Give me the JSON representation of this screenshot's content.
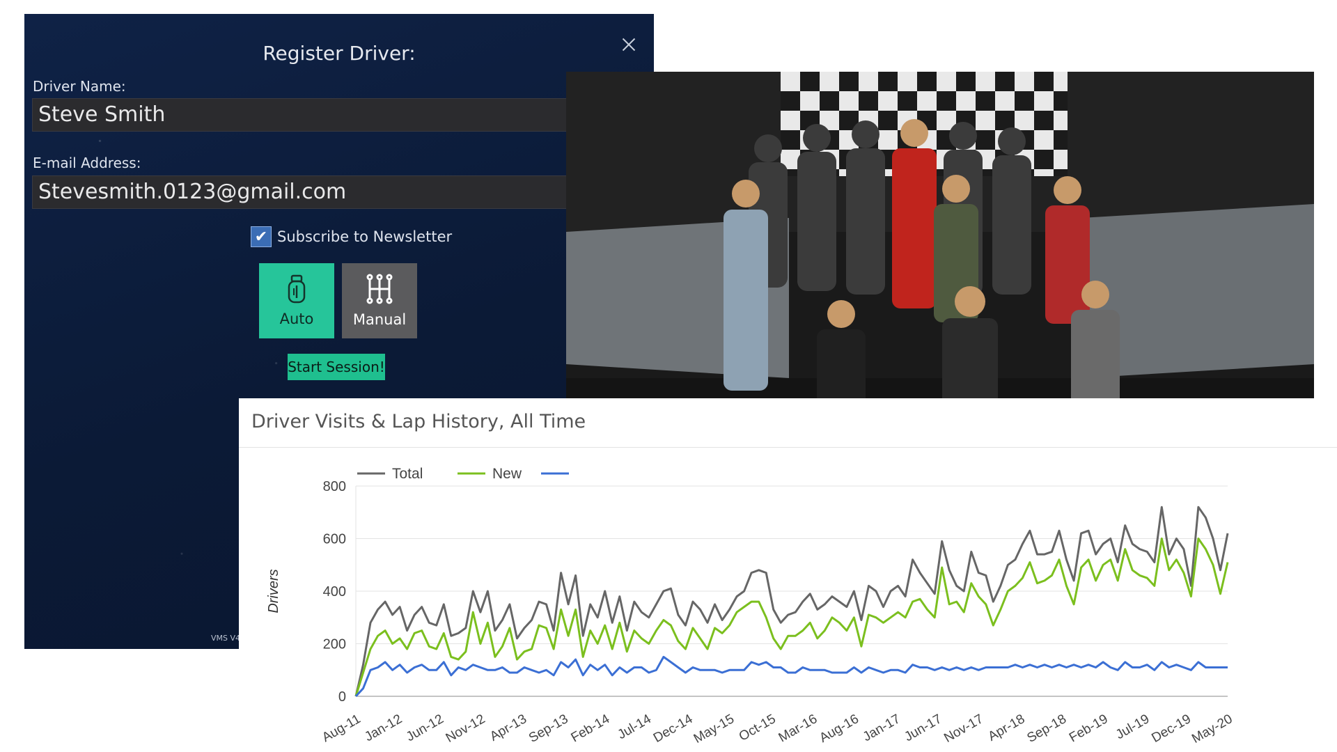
{
  "register": {
    "title": "Register Driver:",
    "name_label": "Driver Name:",
    "name_value": "Steve Smith",
    "email_label": "E-mail Address:",
    "email_value": "Stevesmith.0123@gmail.com",
    "newsletter_label": "Subscribe to Newsletter",
    "newsletter_checked": true,
    "auto_label": "Auto",
    "manual_label": "Manual",
    "start_label": "Start Session!",
    "version": "VMS V4"
  },
  "colors": {
    "panel_bg": "#0e1d3a",
    "auto_bg": "#26c59a",
    "manual_bg": "#5b5b5d",
    "start_bg": "#1fbf8f",
    "total": "#666666",
    "new": "#7bbf1e",
    "returning": "#3b6fd4"
  },
  "chart": {
    "title": "Driver Visits & Lap History, All Time"
  },
  "chart_data": {
    "type": "line",
    "title": "Driver Visits & Lap History, All Time",
    "ylabel": "Drivers",
    "xlabel": "",
    "ylim": [
      0,
      800
    ],
    "yticks": [
      0,
      200,
      400,
      600,
      800
    ],
    "xtick_labels": [
      "Aug-11",
      "Jan-12",
      "Jun-12",
      "Nov-12",
      "Apr-13",
      "Sep-13",
      "Feb-14",
      "Jul-14",
      "Dec-14",
      "May-15",
      "Oct-15",
      "Mar-16",
      "Aug-16",
      "Jan-17",
      "Jun-17",
      "Nov-17",
      "Apr-18",
      "Sep-18",
      "Feb-19",
      "Jul-19",
      "Dec-19",
      "May-20"
    ],
    "legend_position": "top-left",
    "series": [
      {
        "name": "Total",
        "color": "#666666",
        "values": [
          0,
          120,
          280,
          330,
          360,
          310,
          340,
          250,
          310,
          340,
          280,
          270,
          350,
          230,
          240,
          260,
          400,
          320,
          400,
          250,
          290,
          350,
          220,
          260,
          290,
          360,
          350,
          250,
          470,
          350,
          460,
          230,
          350,
          300,
          400,
          280,
          380,
          250,
          360,
          320,
          300,
          350,
          400,
          410,
          310,
          270,
          360,
          330,
          280,
          350,
          290,
          330,
          380,
          400,
          470,
          480,
          470,
          330,
          280,
          310,
          320,
          360,
          390,
          330,
          350,
          380,
          360,
          340,
          400,
          290,
          420,
          400,
          340,
          400,
          420,
          380,
          520,
          470,
          430,
          390,
          590,
          480,
          420,
          400,
          550,
          470,
          460,
          360,
          420,
          500,
          520,
          580,
          630,
          540,
          540,
          550,
          630,
          520,
          440,
          620,
          630,
          540,
          580,
          600,
          510,
          650,
          580,
          560,
          550,
          510,
          720,
          540,
          600,
          560,
          420,
          720,
          680,
          600,
          480,
          620
        ]
      },
      {
        "name": "New",
        "color": "#7bbf1e",
        "values": [
          0,
          90,
          180,
          230,
          250,
          200,
          220,
          180,
          240,
          250,
          190,
          180,
          240,
          150,
          140,
          170,
          320,
          200,
          280,
          150,
          190,
          260,
          140,
          170,
          180,
          270,
          260,
          180,
          330,
          230,
          330,
          150,
          250,
          200,
          270,
          180,
          280,
          170,
          250,
          220,
          200,
          250,
          290,
          270,
          210,
          180,
          260,
          220,
          180,
          260,
          240,
          270,
          320,
          340,
          360,
          360,
          300,
          220,
          180,
          230,
          230,
          250,
          280,
          220,
          250,
          300,
          280,
          250,
          300,
          190,
          310,
          300,
          280,
          300,
          320,
          300,
          360,
          370,
          330,
          300,
          490,
          350,
          360,
          320,
          430,
          380,
          350,
          270,
          330,
          400,
          420,
          450,
          510,
          430,
          440,
          460,
          520,
          420,
          350,
          490,
          520,
          440,
          500,
          520,
          440,
          560,
          480,
          460,
          450,
          420,
          600,
          480,
          520,
          470,
          380,
          600,
          560,
          500,
          390,
          510
        ]
      },
      {
        "name": "",
        "color": "#3b6fd4",
        "values": [
          0,
          30,
          100,
          110,
          130,
          100,
          120,
          90,
          110,
          120,
          100,
          100,
          130,
          80,
          110,
          100,
          120,
          110,
          100,
          100,
          110,
          90,
          90,
          110,
          100,
          90,
          100,
          80,
          130,
          110,
          140,
          80,
          120,
          100,
          120,
          80,
          110,
          90,
          110,
          110,
          90,
          100,
          150,
          130,
          110,
          90,
          110,
          100,
          100,
          100,
          90,
          100,
          100,
          100,
          130,
          120,
          130,
          110,
          110,
          90,
          90,
          110,
          100,
          100,
          100,
          90,
          90,
          90,
          110,
          90,
          110,
          100,
          90,
          100,
          100,
          90,
          120,
          110,
          110,
          100,
          110,
          100,
          110,
          100,
          110,
          100,
          110,
          110,
          110,
          110,
          120,
          110,
          120,
          110,
          120,
          110,
          120,
          110,
          120,
          110,
          120,
          110,
          130,
          110,
          100,
          130,
          110,
          110,
          120,
          100,
          130,
          110,
          120,
          110,
          100,
          130,
          110,
          110,
          110,
          110
        ]
      }
    ]
  }
}
